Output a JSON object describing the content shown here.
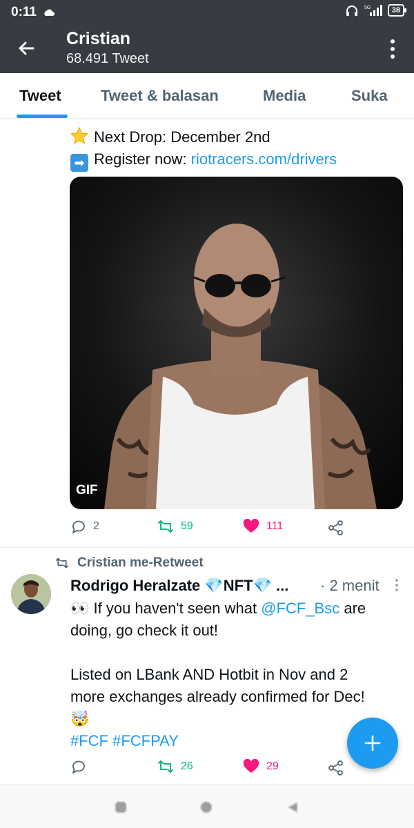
{
  "status_bar": {
    "time": "0:11",
    "network": "5G",
    "battery": "38"
  },
  "header": {
    "title": "Cristian",
    "subtitle": "68.491 Tweet"
  },
  "tabs": [
    {
      "label": "Tweet",
      "active": true
    },
    {
      "label": "Tweet & balasan",
      "active": false
    },
    {
      "label": "Media",
      "active": false
    },
    {
      "label": "Suka",
      "active": false
    }
  ],
  "tweet1": {
    "line1": "Next Drop: December 2nd",
    "line2_prefix": "Register now: ",
    "line2_link": "riotracers.com/drivers",
    "media_badge": "GIF",
    "replies": "2",
    "retweets": "59",
    "likes": "111"
  },
  "tweet2": {
    "retweet_label": "Cristian me-Retweet",
    "author": "Rodrigo Heralzate 💎NFT💎 ...",
    "time": "· 2 menit",
    "line1_prefix": "👀 If you haven't seen what ",
    "line1_mention": "@FCF_Bsc",
    "line1_suffix": " are",
    "line2": "doing, go check it out!",
    "line3": "Listed on LBank AND Hotbit in Nov and 2",
    "line4": "more exchanges already confirmed for Dec!",
    "line5": "🤯",
    "hashtags": "#FCF #FCFPAY",
    "retweets": "26",
    "likes": "29"
  },
  "colors": {
    "header_bg": "#373c43",
    "accent": "#1d9bf0",
    "like": "#f91880",
    "retweet": "#00ba7c",
    "muted": "#536471"
  }
}
